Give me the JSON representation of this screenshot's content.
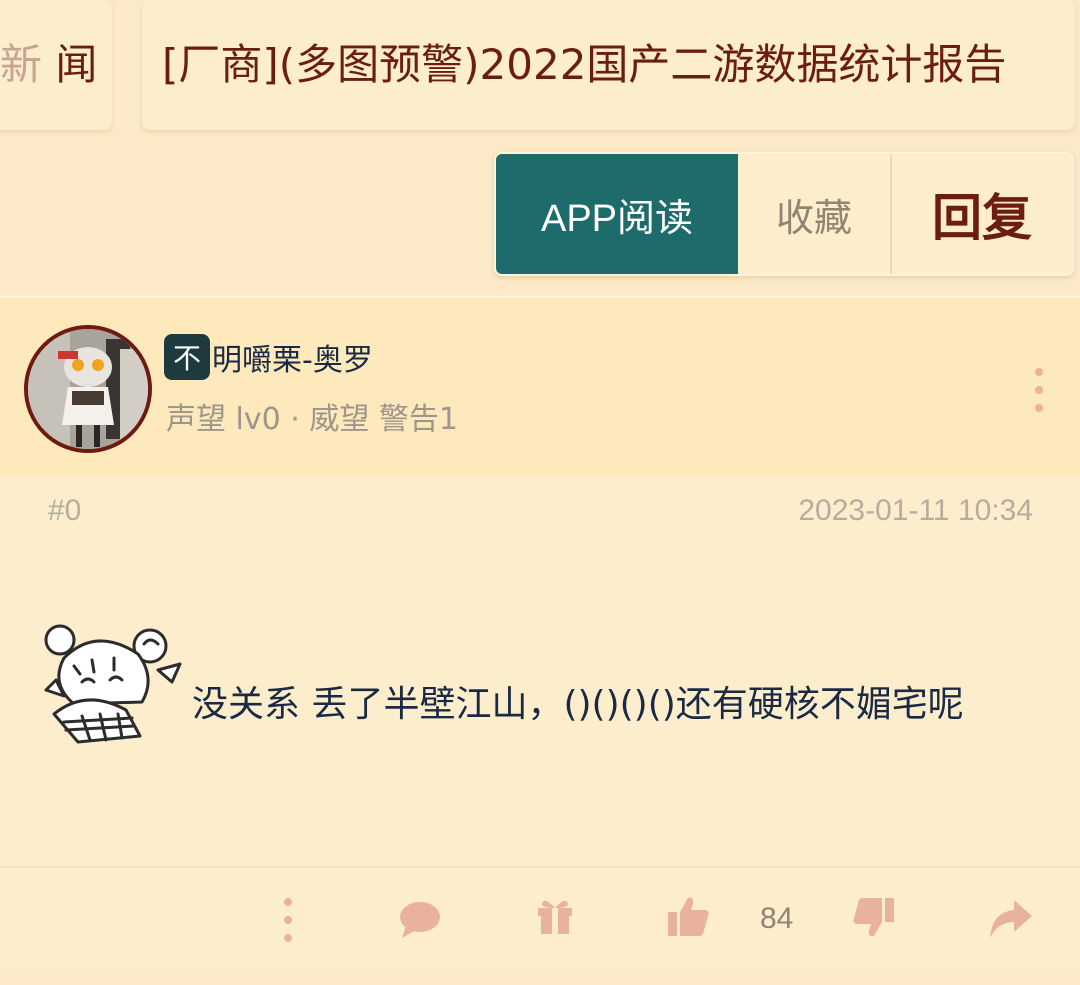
{
  "breadcrumb": {
    "section_faded": "新",
    "section": "闻",
    "title": "[厂商](多图预警)2022国产二游数据统计报告"
  },
  "actions": {
    "app_read": "APP阅读",
    "favorite": "收藏",
    "reply": "回复"
  },
  "post": {
    "user": {
      "badge": "不",
      "name": "明嚼栗-奥罗",
      "meta": "声望 lv0 · 威望 警告1"
    },
    "floor": "#0",
    "timestamp": "2023-01-11 10:34",
    "content": "没关系 丢了半壁江山，()()()()还有硬核不媚宅呢",
    "likes": "84"
  },
  "colors": {
    "accent": "#1d6b6a",
    "title": "#6b1d12",
    "icon": "#e9b29c"
  },
  "icons": [
    "more-vertical-icon",
    "comment-icon",
    "gift-icon",
    "thumbs-up-icon",
    "thumbs-down-icon",
    "share-icon"
  ]
}
